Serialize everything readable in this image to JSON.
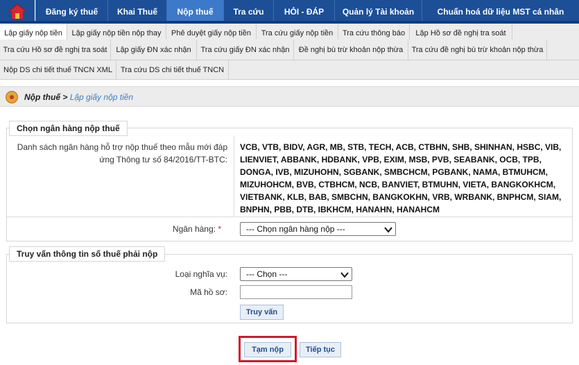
{
  "top_nav": {
    "items": [
      {
        "label": "Đăng ký thuế"
      },
      {
        "label": "Khai Thuế"
      },
      {
        "label": "Nộp thuế"
      },
      {
        "label": "Tra cứu"
      },
      {
        "label": "HỎI - ĐÁP"
      },
      {
        "label": "Quản lý Tài khoản"
      },
      {
        "label": "Chuẩn hoá dữ liệu MST cá nhân"
      }
    ],
    "active": "Nộp thuế"
  },
  "sub_nav": {
    "row1": [
      "Lập giấy nộp tiền",
      "Lập giấy nộp tiền nộp thay",
      "Phê duyệt giấy nộp tiền",
      "Tra cứu giấy nộp tiền",
      "Tra cứu thông báo",
      "Lập Hồ sơ đề nghị tra soát"
    ],
    "row2": [
      "Tra cứu Hồ sơ đề nghị tra soát",
      "Lập giấy ĐN xác nhận",
      "Tra cứu giấy ĐN xác nhận",
      "Đề nghị bù trừ khoản nộp thừa",
      "Tra cứu đề nghị bù trừ khoản nộp thừa"
    ],
    "row3": [
      "Nộp DS chi tiết thuế TNCN XML",
      "Tra cứu DS chi tiết thuế TNCN"
    ]
  },
  "breadcrumb": {
    "parent": "Nộp thuế",
    "sep": " > ",
    "current": "Lập giấy nộp tiền"
  },
  "bank_section": {
    "legend": "Chọn ngân hàng nộp thuế",
    "list_label_1": "Danh sách ngân hàng hỗ trợ nộp thuế theo mẫu mới đáp",
    "list_label_2": "ứng Thông tư số 84/2016/TT-BTC:",
    "bank_lines": [
      "VCB, VTB, BIDV, AGR, MB, STB, TECH, ACB, CTBHN, SHB, SHINHAN, HSBC, VIB,",
      "LIENVIET, ABBANK, HDBANK, VPB, EXIM, MSB, PVB, SEABANK, OCB, TPB,",
      "DONGA, IVB, MIZUHOHN, SGBANK, SMBCHCM, PGBANK, NAMA, BTMUHCM,",
      "MIZUHOHCM, BVB, CTBHCM, NCB, BANVIET, BTMUHN, VIETA, BANGKOKHCM,",
      "VIETBANK, KLB, BAB, SMBCHN, BANGKOKHN, VRB, WRBANK, BNPHCM, SIAM,",
      "BNPHN, PBB, DTB, IBKHCM, HANAHN, HANAHCM"
    ],
    "bank_label": "Ngân hàng:",
    "required_mark": "*",
    "bank_select_value": "--- Chọn ngân hàng nộp ---"
  },
  "query_section": {
    "legend": "Truy vấn thông tin số thuế phải nộp",
    "obligation_label": "Loại nghĩa vụ:",
    "obligation_value": "--- Chọn ---",
    "dossier_label": "Mã hồ sơ:",
    "dossier_value": "",
    "query_button": "Truy vấn"
  },
  "actions": {
    "temp_submit": "Tạm nộp",
    "continue": "Tiếp tục"
  },
  "colors": {
    "nav_bg": "#1c4f96",
    "nav_active": "#3d79c9",
    "link": "#3a7ec7",
    "highlight": "#d4182b"
  }
}
